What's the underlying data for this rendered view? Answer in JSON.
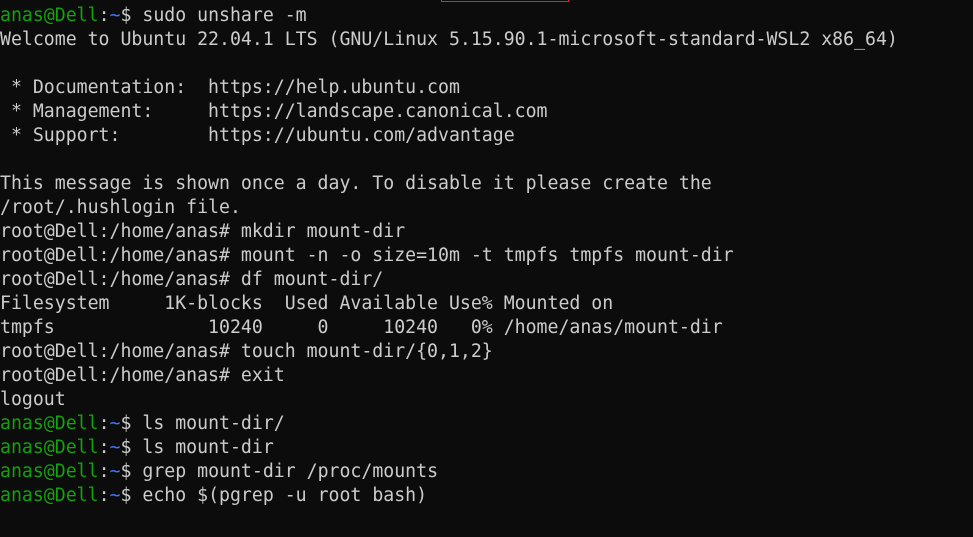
{
  "colors": {
    "background": "#0c0c0c",
    "foreground": "#cccccc",
    "user_prompt": "#13a10e",
    "path": "#3b78ff",
    "top_remnant": "#ee2222"
  },
  "terminal": {
    "prompt_user": "anas@Dell",
    "prompt_path": "~",
    "lines": [
      {
        "kind": "user_prompt",
        "command": "sudo unshare -m"
      },
      {
        "kind": "output",
        "text": "Welcome to Ubuntu 22.04.1 LTS (GNU/Linux 5.15.90.1-microsoft-standard-WSL2 x86_64)"
      },
      {
        "kind": "output",
        "text": ""
      },
      {
        "kind": "output",
        "text": " * Documentation:  https://help.ubuntu.com"
      },
      {
        "kind": "output",
        "text": " * Management:     https://landscape.canonical.com"
      },
      {
        "kind": "output",
        "text": " * Support:        https://ubuntu.com/advantage"
      },
      {
        "kind": "output",
        "text": ""
      },
      {
        "kind": "output",
        "text": "This message is shown once a day. To disable it please create the"
      },
      {
        "kind": "output",
        "text": "/root/.hushlogin file."
      },
      {
        "kind": "output",
        "text": "root@Dell:/home/anas# mkdir mount-dir"
      },
      {
        "kind": "output",
        "text": "root@Dell:/home/anas# mount -n -o size=10m -t tmpfs tmpfs mount-dir"
      },
      {
        "kind": "output",
        "text": "root@Dell:/home/anas# df mount-dir/"
      },
      {
        "kind": "output",
        "text": "Filesystem     1K-blocks  Used Available Use% Mounted on"
      },
      {
        "kind": "output",
        "text": "tmpfs              10240     0     10240   0% /home/anas/mount-dir"
      },
      {
        "kind": "output",
        "text": "root@Dell:/home/anas# touch mount-dir/{0,1,2}"
      },
      {
        "kind": "output",
        "text": "root@Dell:/home/anas# exit"
      },
      {
        "kind": "output",
        "text": "logout"
      },
      {
        "kind": "user_prompt",
        "command": "ls mount-dir/"
      },
      {
        "kind": "user_prompt",
        "command": "ls mount-dir"
      },
      {
        "kind": "user_prompt",
        "command": "grep mount-dir /proc/mounts"
      },
      {
        "kind": "user_prompt",
        "command": "echo $(pgrep -u root bash)"
      }
    ]
  }
}
